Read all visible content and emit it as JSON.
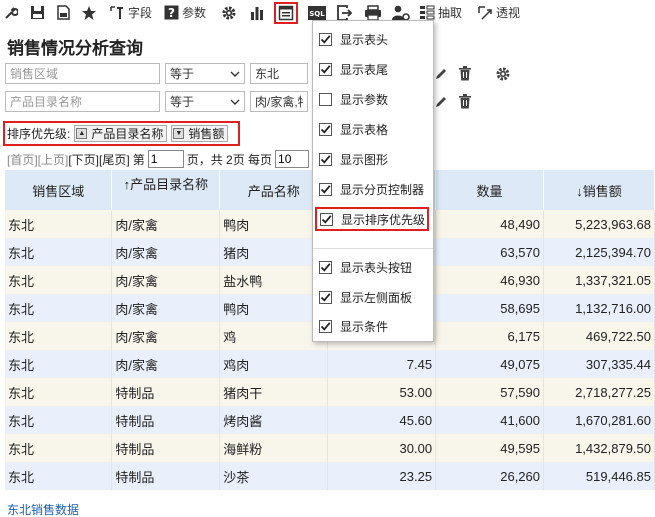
{
  "toolbar": {
    "field_label": "字段",
    "param_label": "参数",
    "extract_label": "抽取",
    "pivot_label": "透视"
  },
  "page_title": "销售情况分析查询",
  "conditions": [
    {
      "field_placeholder": "销售区域",
      "operator": "等于",
      "value": "东北"
    },
    {
      "field_placeholder": "产品目录名称",
      "operator": "等于",
      "value": "肉/家禽,特"
    }
  ],
  "sort": {
    "label": "排序优先级:",
    "items": [
      "产品目录名称",
      "销售额"
    ]
  },
  "pager": {
    "first": "[首页]",
    "prev": "[上页]",
    "next": "[下页]",
    "last": "[尾页]",
    "page_prefix": "第",
    "page_value": "1",
    "page_suffix": "页，共 2页 每页",
    "page_size": "10"
  },
  "table": {
    "headers": [
      "销售区域",
      "↑产品目录名称",
      "产品名称",
      "",
      "数量",
      "↓销售额"
    ],
    "rows": [
      [
        "东北",
        "肉/家禽",
        "鸭肉",
        "",
        "48,490",
        "5,223,963.68"
      ],
      [
        "东北",
        "肉/家禽",
        "猪肉",
        "",
        "63,570",
        "2,125,394.70"
      ],
      [
        "东北",
        "肉/家禽",
        "盐水鸭",
        "",
        "46,930",
        "1,337,321.05"
      ],
      [
        "东北",
        "肉/家禽",
        "鸭肉",
        "",
        "58,695",
        "1,132,716.00"
      ],
      [
        "东北",
        "肉/家禽",
        "鸡",
        "",
        "6,175",
        "469,722.50"
      ],
      [
        "东北",
        "肉/家禽",
        "鸡肉",
        "7.45",
        "49,075",
        "307,335.44"
      ],
      [
        "东北",
        "特制品",
        "猪肉干",
        "53.00",
        "57,590",
        "2,718,277.25"
      ],
      [
        "东北",
        "特制品",
        "烤肉酱",
        "45.60",
        "41,600",
        "1,670,281.60"
      ],
      [
        "东北",
        "特制品",
        "海鲜粉",
        "30.00",
        "49,595",
        "1,432,879.50"
      ],
      [
        "东北",
        "特制品",
        "沙茶",
        "23.25",
        "26,260",
        "519,446.85"
      ]
    ]
  },
  "footer_link": "东北销售数据",
  "menu": {
    "items": [
      {
        "label": "显示表头",
        "checked": true
      },
      {
        "label": "显示表尾",
        "checked": true
      },
      {
        "label": "显示参数",
        "checked": false
      },
      {
        "label": "显示表格",
        "checked": true
      },
      {
        "label": "显示图形",
        "checked": true
      },
      {
        "label": "显示分页控制器",
        "checked": true
      },
      {
        "label": "显示排序优先级",
        "checked": true
      },
      {
        "label": "显示表头按钮",
        "checked": true
      },
      {
        "label": "显示左侧面板",
        "checked": true
      },
      {
        "label": "显示条件",
        "checked": true
      }
    ]
  },
  "colors": {
    "accent_red": "#e02020",
    "header_blue": "#dde9f7",
    "row_beige": "#f8f5ea",
    "row_blue": "#eaf0fb",
    "link_blue": "#1a5fb4"
  },
  "icons": [
    "wrench-icon",
    "save-icon",
    "save-as-icon",
    "star-icon",
    "field-icon",
    "help-icon",
    "gear-icon",
    "chart-icon",
    "layout-icon",
    "sql-icon",
    "export-icon",
    "print-icon",
    "user-icon",
    "extract-icon",
    "pivot-icon"
  ]
}
